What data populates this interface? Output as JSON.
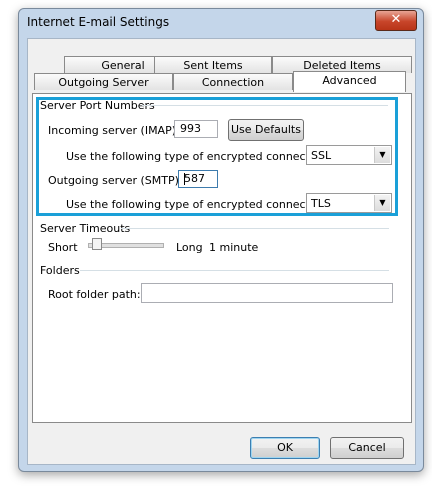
{
  "window": {
    "title": "Internet E-mail Settings",
    "close_glyph": "✕"
  },
  "tabs": {
    "row1": [
      "General",
      "Sent Items",
      "Deleted Items"
    ],
    "row2": [
      "Outgoing Server",
      "Connection",
      "Advanced"
    ],
    "active": "Advanced"
  },
  "ports": {
    "group_label": "Server Port Numbers",
    "incoming_label": "Incoming server (IMAP):",
    "incoming_value": "993",
    "use_defaults": "Use Defaults",
    "enc_label_in": "Use the following type of encrypted connection:",
    "enc_in_value": "SSL",
    "outgoing_label": "Outgoing server (SMTP):",
    "outgoing_value": "587",
    "enc_label_out": "Use the following type of encrypted connection:",
    "enc_out_value": "TLS"
  },
  "timeouts": {
    "group_label": "Server Timeouts",
    "short": "Short",
    "long": "Long",
    "value": "1 minute",
    "level": 0.05
  },
  "folders": {
    "group_label": "Folders",
    "root_label": "Root folder path:",
    "root_value": ""
  },
  "buttons": {
    "ok": "OK",
    "cancel": "Cancel"
  },
  "colors": {
    "highlight": "#1aa0d8",
    "titlebar": "#c4d6ea",
    "close": "#c8452a"
  }
}
